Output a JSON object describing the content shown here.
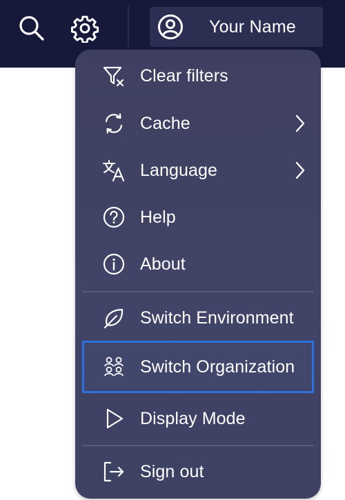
{
  "header": {
    "search_icon": "search-icon",
    "settings_icon": "gear-icon",
    "user": {
      "avatar_icon": "user-circle-icon",
      "name": "Your Name"
    }
  },
  "menu": {
    "items": [
      {
        "label": "Clear filters",
        "icon": "filter-clear-icon",
        "has_submenu": false
      },
      {
        "label": "Cache",
        "icon": "refresh-icon",
        "has_submenu": true
      },
      {
        "label": "Language",
        "icon": "translate-icon",
        "has_submenu": true
      },
      {
        "label": "Help",
        "icon": "help-circle-icon",
        "has_submenu": false
      },
      {
        "label": "About",
        "icon": "info-circle-icon",
        "has_submenu": false
      },
      {
        "label": "Switch Environment",
        "icon": "leaf-icon",
        "has_submenu": false
      },
      {
        "label": "Switch Organization",
        "icon": "people-group-icon",
        "has_submenu": false,
        "focused": true
      },
      {
        "label": "Display Mode",
        "icon": "play-triangle-icon",
        "has_submenu": false
      },
      {
        "label": "Sign out",
        "icon": "sign-out-icon",
        "has_submenu": false
      }
    ]
  },
  "colors": {
    "topbar": "#17193a",
    "user_button": "#2c2f52",
    "menu_background": "#404263",
    "focus_outline": "#2f6fe0",
    "text": "#ffffff"
  }
}
